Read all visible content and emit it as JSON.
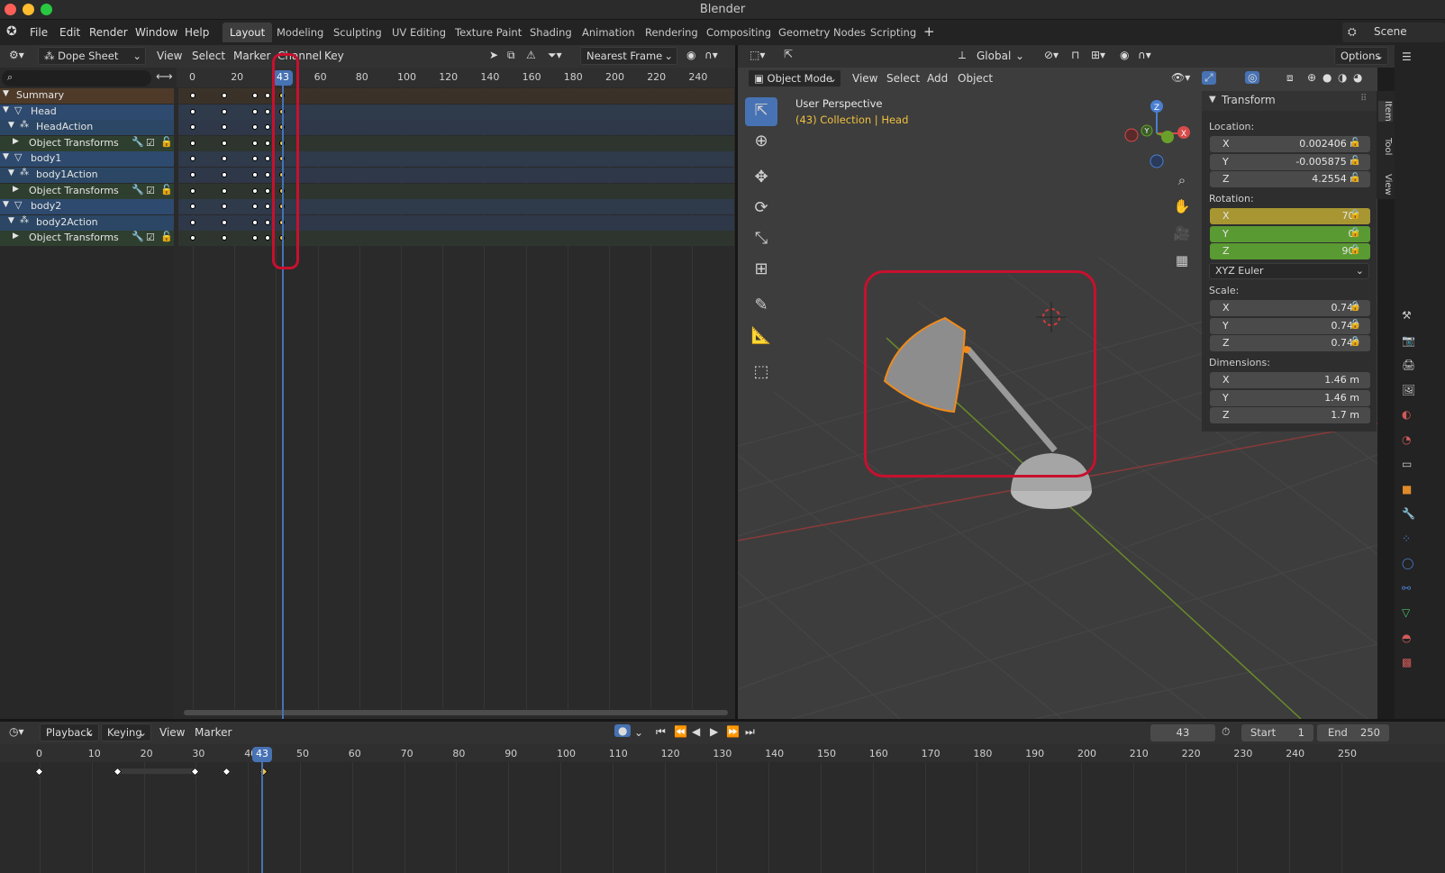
{
  "window": {
    "title": "Blender"
  },
  "menu": [
    "File",
    "Edit",
    "Render",
    "Window",
    "Help"
  ],
  "workspaces": [
    {
      "label": "Layout",
      "active": true
    },
    {
      "label": "Modeling"
    },
    {
      "label": "Sculpting"
    },
    {
      "label": "UV Editing"
    },
    {
      "label": "Texture Paint"
    },
    {
      "label": "Shading"
    },
    {
      "label": "Animation"
    },
    {
      "label": "Rendering"
    },
    {
      "label": "Compositing"
    },
    {
      "label": "Geometry Nodes"
    },
    {
      "label": "Scripting"
    }
  ],
  "scene": {
    "label": "Scene"
  },
  "dopesheet": {
    "mode": "Dope Sheet",
    "menus": [
      "View",
      "Select",
      "Marker",
      "Channel",
      "Key"
    ],
    "snap": "Nearest Frame",
    "current_frame": "43",
    "ruler": [
      "0",
      "20",
      "40",
      "60",
      "80",
      "100",
      "120",
      "140",
      "160",
      "180",
      "200",
      "220",
      "240"
    ],
    "channels": [
      {
        "label": "Summary",
        "type": "summary",
        "keys": [
          0,
          15,
          30,
          36,
          43
        ]
      },
      {
        "label": "Head",
        "type": "object",
        "keys": [
          0,
          15,
          30,
          36,
          43
        ]
      },
      {
        "label": "HeadAction",
        "type": "action",
        "keys": [
          0,
          15,
          30,
          36,
          43
        ]
      },
      {
        "label": "Object Transforms",
        "type": "group",
        "keys": [
          0,
          15,
          30,
          36,
          43
        ]
      },
      {
        "label": "body1",
        "type": "object",
        "keys": [
          0,
          15,
          30,
          36,
          43
        ]
      },
      {
        "label": "body1Action",
        "type": "action",
        "keys": [
          0,
          15,
          30,
          36,
          43
        ]
      },
      {
        "label": "Object Transforms",
        "type": "group",
        "keys": [
          0,
          15,
          30,
          36,
          43
        ]
      },
      {
        "label": "body2",
        "type": "object",
        "keys": [
          0,
          15,
          30,
          36,
          43
        ]
      },
      {
        "label": "body2Action",
        "type": "action",
        "keys": [
          0,
          15,
          30,
          36,
          43
        ]
      },
      {
        "label": "Object Transforms",
        "type": "group",
        "keys": [
          0,
          15,
          30,
          36,
          43
        ]
      }
    ]
  },
  "viewport": {
    "orientation": "Global",
    "mode": "Object Mode",
    "menus": [
      "View",
      "Select",
      "Add",
      "Object"
    ],
    "options": "Options",
    "perspective": "User Perspective",
    "collection": "(43) Collection | Head",
    "gizmo": {
      "x": "X",
      "y": "Y",
      "z": "Z"
    }
  },
  "transform": {
    "title": "Transform",
    "location_label": "Location:",
    "location": [
      {
        "axis": "X",
        "value": "0.002406 m"
      },
      {
        "axis": "Y",
        "value": "-0.005875 m"
      },
      {
        "axis": "Z",
        "value": "4.2554 m"
      }
    ],
    "rotation_label": "Rotation:",
    "rotation": [
      {
        "axis": "X",
        "value": "70°"
      },
      {
        "axis": "Y",
        "value": "0°"
      },
      {
        "axis": "Z",
        "value": "90°"
      }
    ],
    "rotation_mode": "XYZ Euler",
    "scale_label": "Scale:",
    "scale": [
      {
        "axis": "X",
        "value": "0.740"
      },
      {
        "axis": "Y",
        "value": "0.740"
      },
      {
        "axis": "Z",
        "value": "0.740"
      }
    ],
    "dimensions_label": "Dimensions:",
    "dimensions": [
      {
        "axis": "X",
        "value": "1.46 m"
      },
      {
        "axis": "Y",
        "value": "1.46 m"
      },
      {
        "axis": "Z",
        "value": "1.7 m"
      }
    ]
  },
  "sidebar_tabs": [
    "Item",
    "Tool",
    "View"
  ],
  "timeline": {
    "menus": [
      "Playback",
      "Keying",
      "View",
      "Marker"
    ],
    "current_frame": "43",
    "start_label": "Start",
    "start": "1",
    "end_label": "End",
    "end": "250",
    "ruler": [
      "0",
      "10",
      "20",
      "30",
      "40",
      "50",
      "60",
      "70",
      "80",
      "90",
      "100",
      "110",
      "120",
      "130",
      "140",
      "150",
      "160",
      "170",
      "180",
      "190",
      "200",
      "210",
      "220",
      "230",
      "240",
      "250"
    ],
    "keys": [
      0,
      15,
      30,
      36,
      43
    ]
  },
  "colors": {
    "accent": "#4772b3",
    "highlight": "#c8102e",
    "selected_key": "#f3c04a",
    "rot_x": "#a79632",
    "rot_yz": "#5a9a32"
  }
}
